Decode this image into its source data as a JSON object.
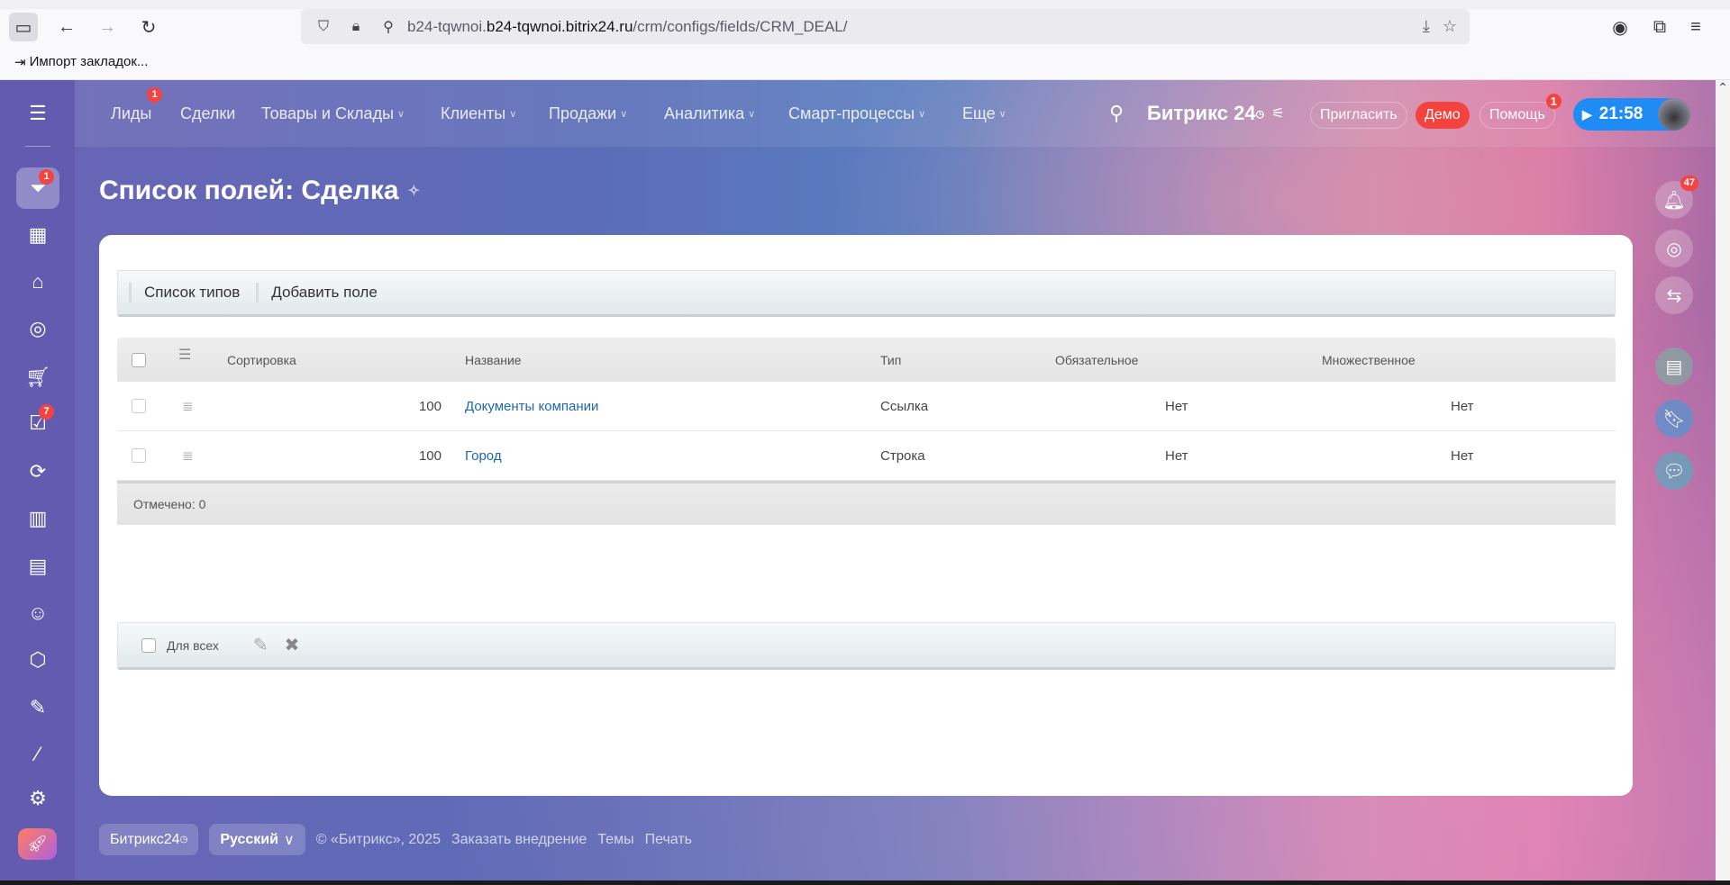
{
  "browser": {
    "url_host": "b24-tqwnoi.bitrix24.ru",
    "url_path": "/crm/configs/fields/CRM_DEAL/",
    "url_prefix": "b24-tqwnoi.",
    "bookmark": "Импорт закладок..."
  },
  "nav": {
    "items": [
      {
        "label": "Лиды",
        "badge": "1"
      },
      {
        "label": "Сделки"
      },
      {
        "label": "Товары и Склады"
      },
      {
        "label": "Клиенты"
      },
      {
        "label": "Продажи"
      },
      {
        "label": "Аналитика"
      },
      {
        "label": "Смарт-процессы"
      },
      {
        "label": "Еще"
      }
    ],
    "logo": "Битрикс 24",
    "invite": "Пригласить",
    "demo": "Демо",
    "help": "Помощь",
    "help_badge": "1",
    "timer": "21:58"
  },
  "sidebar": {
    "badges": {
      "crm": "1",
      "tasks": "7"
    }
  },
  "page": {
    "title": "Список полей: Сделка"
  },
  "toolbar": {
    "types": "Список типов",
    "add": "Добавить поле"
  },
  "grid": {
    "headers": {
      "sort": "Сортировка",
      "name": "Название",
      "type": "Тип",
      "required": "Обязательное",
      "multiple": "Множественное"
    },
    "rows": [
      {
        "sort": "100",
        "name": "Документы компании",
        "type": "Ссылка",
        "required": "Нет",
        "multiple": "Нет"
      },
      {
        "sort": "100",
        "name": "Город",
        "type": "Строка",
        "required": "Нет",
        "multiple": "Нет"
      }
    ],
    "checked": "Отмечено: 0"
  },
  "actions": {
    "for_all": "Для всех"
  },
  "right": {
    "notifications": "47"
  },
  "footer": {
    "brand": "Битрикс24",
    "lang": "Русский",
    "copyright": "© «Битрикс», 2025",
    "order": "Заказать внедрение",
    "themes": "Темы",
    "print": "Печать"
  }
}
